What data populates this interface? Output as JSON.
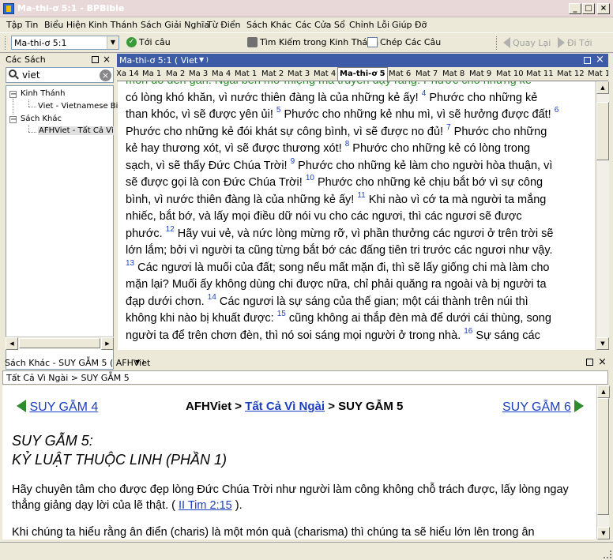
{
  "window": {
    "title": "Ma-thi-ơ 5:1 - BPBible"
  },
  "menu": [
    "Tập Tin",
    "Biểu Hiện",
    "Kinh Thánh",
    "Sách Giải Nghĩa",
    "Từ Điển",
    "Sách Khác",
    "Các Cửa Sổ",
    "Chỉnh Lỗi",
    "Giúp Đỡ"
  ],
  "toolbar": {
    "reference": "Ma-thi-ơ 5:1",
    "goto": "Tới câu",
    "search": "Tìm Kiếm trong Kinh Thánh",
    "copy": "Chép Các Câu",
    "back": "Quay Lại",
    "forward": "Đi Tới"
  },
  "left_panel": {
    "title": "Các Sách",
    "search_value": "viet",
    "tree": [
      {
        "label": "Kinh Thánh",
        "expander": "−"
      },
      {
        "label": "Viet - Vietnamese Bi"
      },
      {
        "label": "Sách Khác",
        "expander": "−"
      },
      {
        "label": "AFHViet - Tất Cả Vì"
      }
    ]
  },
  "bible": {
    "header": "Ma-thi-ơ 5:1 ( Viet",
    "tabs": [
      "Xa 14",
      "Ma 1",
      "Ma 2",
      "Ma 3",
      "Ma 4",
      "Mat 1",
      "Mat 2",
      "Mat 3",
      "Mat 4",
      "Ma-thi-ơ 5",
      "Mat 6",
      "Mat 7",
      "Mat 8",
      "Mat 9",
      "Mat 10",
      "Mat 11",
      "Mat 12",
      "Mat 1"
    ],
    "active_tab": "Ma-thi-ơ 5",
    "lines": [
      "môn đồ đến gần.  Ngài bèn mở miệng mà truyền dạy rằng:  Phước cho những kẻ",
      "có lòng khó khăn, vì nước thiên đàng là của những kẻ ấy! {4} Phước cho những kẻ",
      "than khóc, vì sẽ được yên ủi! {5} Phước cho những kẻ nhu mì, vì sẽ hưởng được đất! {6}",
      "Phước cho những kẻ đói khát sự công bình, vì sẽ được no đủ! {7} Phước cho những",
      "kẻ hay thương xót, vì sẽ được thương xót! {8} Phước cho những kẻ có lòng trong",
      "sạch, vì sẽ thấy Đức Chúa Trời! {9} Phước cho những kẻ làm cho người hòa thuận, vì",
      "sẽ được gọi là con Đức Chúa Trời! {10} Phước cho những kẻ chịu bắt bớ vì sự công",
      "bình, vì nước thiên đàng là của những kẻ ấy! {11} Khi nào vì cớ ta mà người ta mắng",
      "nhiếc, bắt bớ, và lấy mọi điều dữ nói vu cho các ngươi, thì các ngươi sẽ được",
      "phước. {12} Hãy vui vẻ, và nức lòng mừng rỡ, vì phần thưởng các ngươi ở trên trời sẽ",
      "lớn lắm; bởi vì người ta cũng từng bắt bớ các đấng tiên tri trước các ngươi như vậy.",
      "{13} Các ngươi là muối của đất; song nếu mất mặn đi, thì sẽ lấy giống chi mà làm cho",
      "mặn lại? Muối ấy không dùng chi được nữa, chỉ phải quăng ra ngoài và bị người ta",
      "đạp dưới chơn. {14} Các ngươi là sự sáng của thế gian; một cái thành trên núi thì",
      "không khi nào bị khuất được: {15} cũng không ai thắp đèn mà để dưới cái thùng, song",
      "người ta để trên chơn đèn, thì nó soi sáng mọi người ở trong nhà. {16} Sự sáng các"
    ]
  },
  "commentary": {
    "header": "Sách Khác - SUY GẪM 5 ( AFHViet",
    "breadcrumb": "Tất Cả Vì Ngài > SUY GẪM 5",
    "prev": "SUY GẪM 4",
    "next": "SUY GẪM 6",
    "center_pre": "AFHViet > ",
    "center_link": "Tất Cả Vì Ngài",
    "center_post": " > SUY GẪM 5",
    "heading1": "SUY GẪM 5:",
    "heading2": "KỶ LUẬT THUỘC LINH (PHẦN 1)",
    "para1": "Hãy chuyên tâm cho được đẹp lòng Đức Chúa Trời như người làm công không chỗ trách được, lấy lòng ngay thẳng giảng dạy lời của lẽ thật. ( ",
    "para1_link": "II Tim 2:15",
    "para1_end": " ).",
    "para2": "Khi chúng ta hiểu rằng ân điển (charis) là một món quà (charisma) thì chúng ta sẽ hiểu lớn lên trong ân"
  },
  "colors": {
    "titlebar_text": "#ffffff",
    "bible_header": "#3d5ba7",
    "link": "#1a3fbf",
    "nav_arrow": "#2e8b2e"
  }
}
